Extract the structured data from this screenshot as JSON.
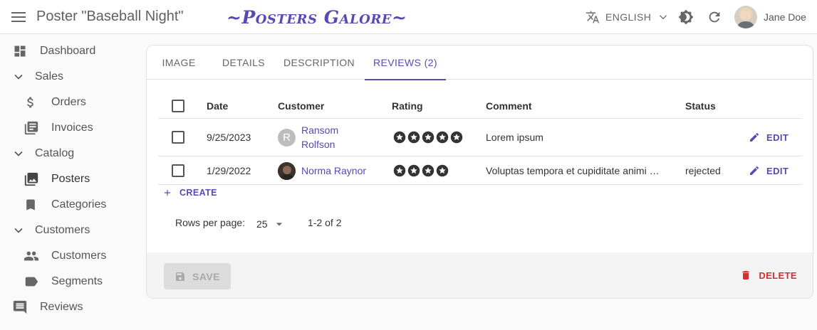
{
  "header": {
    "title": "Poster \"Baseball Night\"",
    "brand": "~Posters Galore~",
    "language": "ENGLISH",
    "user_name": "Jane Doe"
  },
  "sidebar": {
    "items": [
      {
        "label": "Dashboard",
        "icon": "dashboard-icon"
      },
      {
        "label": "Sales",
        "icon": "chevron-down-icon"
      },
      {
        "label": "Orders",
        "icon": "dollar-icon"
      },
      {
        "label": "Invoices",
        "icon": "invoices-icon"
      },
      {
        "label": "Catalog",
        "icon": "chevron-down-icon"
      },
      {
        "label": "Posters",
        "icon": "image-icon"
      },
      {
        "label": "Categories",
        "icon": "bookmark-icon"
      },
      {
        "label": "Customers",
        "icon": "chevron-down-icon"
      },
      {
        "label": "Customers",
        "icon": "people-icon"
      },
      {
        "label": "Segments",
        "icon": "label-icon"
      },
      {
        "label": "Reviews",
        "icon": "comment-icon"
      }
    ]
  },
  "tabs": [
    "IMAGE",
    "DETAILS",
    "DESCRIPTION",
    "REVIEWS (2)"
  ],
  "table": {
    "columns": [
      "Date",
      "Customer",
      "Rating",
      "Comment",
      "Status"
    ],
    "rows": [
      {
        "date": "9/25/2023",
        "customer_line1": "Ransom",
        "customer_line2": "Rolfson",
        "avatar_initial": "R",
        "rating": 5,
        "comment": "Lorem ipsum",
        "status": "",
        "edit": "EDIT"
      },
      {
        "date": "1/29/2022",
        "customer": "Norma Raynor",
        "rating": 4,
        "comment": "Voluptas tempora et cupiditate animi …",
        "status": "rejected",
        "edit": "EDIT"
      }
    ]
  },
  "create_label": "CREATE",
  "pagination": {
    "rows_per_page_label": "Rows per page:",
    "rows_per_page": "25",
    "range": "1-2 of 2"
  },
  "toolbar": {
    "save_label": "SAVE",
    "delete_label": "DELETE"
  },
  "colors": {
    "accent": "#5a48b4",
    "danger": "#d32f2f"
  }
}
